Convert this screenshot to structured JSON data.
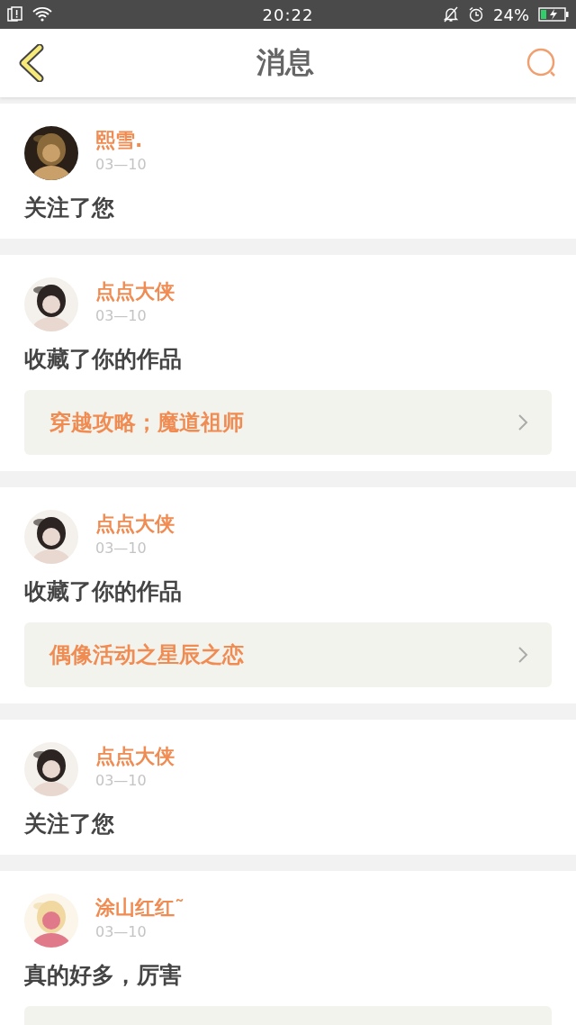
{
  "status_bar": {
    "time": "20:22",
    "battery_text": "24%",
    "charging": true
  },
  "header": {
    "title": "消息"
  },
  "messages": [
    {
      "user": "熙雪.",
      "date": "03—10",
      "text": "关注了您",
      "has_work": false
    },
    {
      "user": "点点大侠",
      "date": "03—10",
      "text": "收藏了你的作品",
      "has_work": true,
      "work_title": "穿越攻略；魔道祖师"
    },
    {
      "user": "点点大侠",
      "date": "03—10",
      "text": "收藏了你的作品",
      "has_work": true,
      "work_title": "偶像活动之星辰之恋"
    },
    {
      "user": "点点大侠",
      "date": "03—10",
      "text": "关注了您",
      "has_work": false
    },
    {
      "user": "涂山红红˜",
      "date": "03—10",
      "text": "真的好多，厉害",
      "has_work": true
    }
  ]
}
